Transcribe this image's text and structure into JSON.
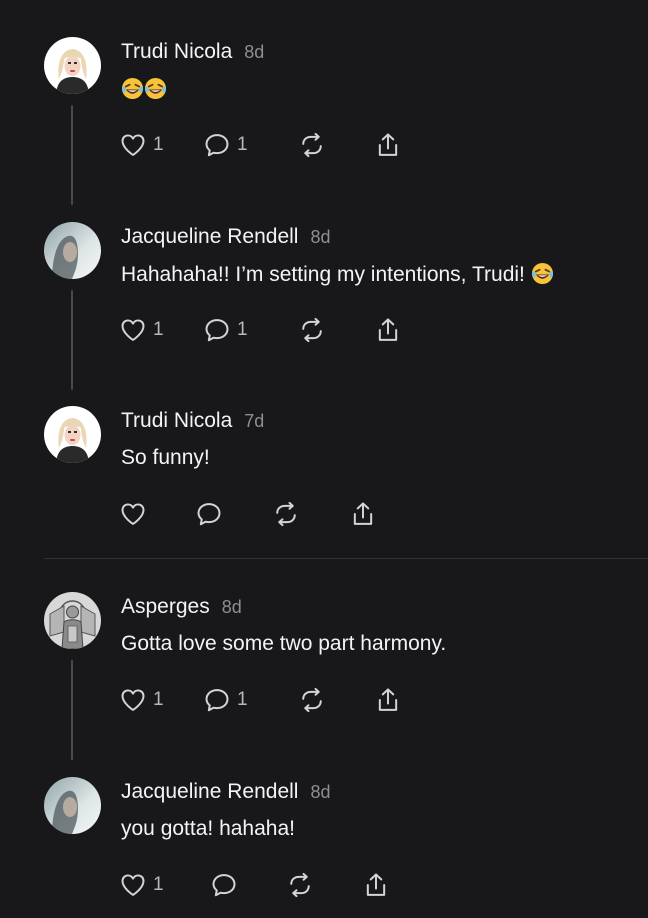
{
  "colors": {
    "background": "#18181b",
    "text": "#f4f4f4",
    "muted": "#8e8e93",
    "icon": "#d4d4d8"
  },
  "posts": [
    {
      "author": "Trudi Nicola",
      "time": "8d",
      "text": "",
      "emoji": "😂😂",
      "avatar": "trudi",
      "likes": "1",
      "replies": "1"
    },
    {
      "author": "Jacqueline Rendell",
      "time": "8d",
      "text": "Hahahaha!! I’m setting my intentions, Trudi!",
      "emoji": "😂",
      "avatar": "jacqueline",
      "likes": "1",
      "replies": "1"
    },
    {
      "author": "Trudi Nicola",
      "time": "7d",
      "text": "So funny!",
      "emoji": "",
      "avatar": "trudi",
      "likes": "",
      "replies": ""
    },
    {
      "author": "Asperges",
      "time": "8d",
      "text": "Gotta love some two part harmony.",
      "emoji": "",
      "avatar": "asperges",
      "likes": "1",
      "replies": "1"
    },
    {
      "author": "Jacqueline Rendell",
      "time": "8d",
      "text": "you gotta! hahaha!",
      "emoji": "",
      "avatar": "jacqueline",
      "likes": "1",
      "replies": ""
    }
  ],
  "icons": [
    "heart-icon",
    "comment-icon",
    "repost-icon",
    "share-icon"
  ]
}
